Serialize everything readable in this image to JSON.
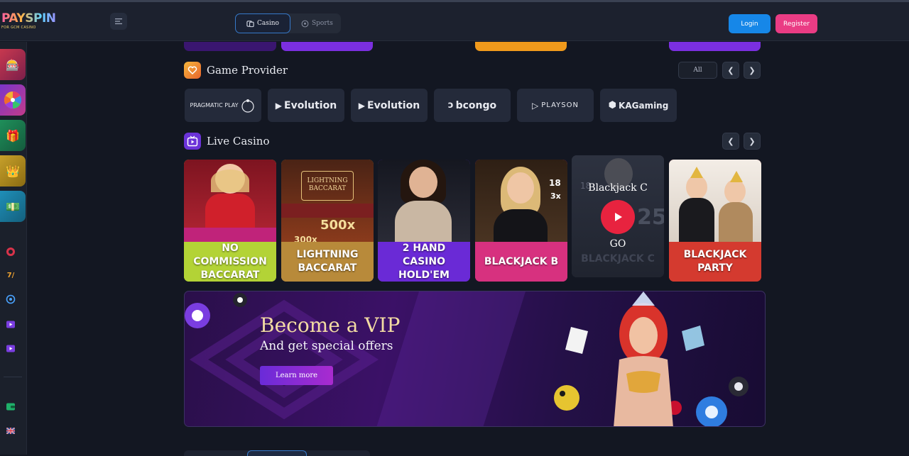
{
  "brand": {
    "name": "PAYSPIN",
    "tagline": "FOR GCM CASINO"
  },
  "header": {
    "tabs": [
      {
        "label": "Casino",
        "icon": "casino-icon",
        "active": true
      },
      {
        "label": "Sports",
        "icon": "soccer-ball-icon",
        "active": false
      }
    ],
    "login_label": "Login",
    "register_label": "Register"
  },
  "sidebar": {
    "tiles": [
      "slots-tile-icon",
      "wheel-tile-icon",
      "gift-tile-icon",
      "crown-tile-icon",
      "cash-tile-icon"
    ],
    "links": [
      "chip-icon",
      "sevens-icon",
      "settings-icon",
      "live-tv-icon",
      "live-tv-icon"
    ],
    "bottom": [
      "wallet-icon",
      "uk-flag-icon"
    ]
  },
  "game_provider": {
    "title": "Game Provider",
    "all_label": "All",
    "providers": [
      {
        "name": "PRAGMATIC PLAY"
      },
      {
        "name": "Evolution"
      },
      {
        "name": "Evolution"
      },
      {
        "name": "bcongo"
      },
      {
        "name": "PLAYSON"
      },
      {
        "name": "KAGaming"
      }
    ]
  },
  "live_casino": {
    "title": "Live Casino",
    "games": [
      {
        "name": "NO COMMISSION BACCARAT",
        "bg": "#b3d336"
      },
      {
        "name": "LIGHTNING BACCARAT",
        "bg": "#b88a3a"
      },
      {
        "name": "2 HAND CASINO HOLD'EM",
        "bg": "#6a2ad6"
      },
      {
        "name": "BLACKJACK B",
        "bg": "#d7317f"
      },
      {
        "name": "BLACKJACK C",
        "bg": "#2a2f3d",
        "hover_title": "Blackjack C",
        "hover_action": "GO"
      },
      {
        "name": "BLACKJACK PARTY",
        "bg": "#d43a2f"
      }
    ],
    "badges": {
      "lightning_mult": "500x",
      "lightning_mult2": "300x",
      "blackjack_b_seat": "18",
      "blackjack_b_mult": "3x",
      "blackjack_c_seat": "18",
      "blackjack_c_num": "25"
    }
  },
  "vip_banner": {
    "title": "Become a VIP",
    "subtitle": "And get special offers",
    "cta": "Learn more"
  }
}
